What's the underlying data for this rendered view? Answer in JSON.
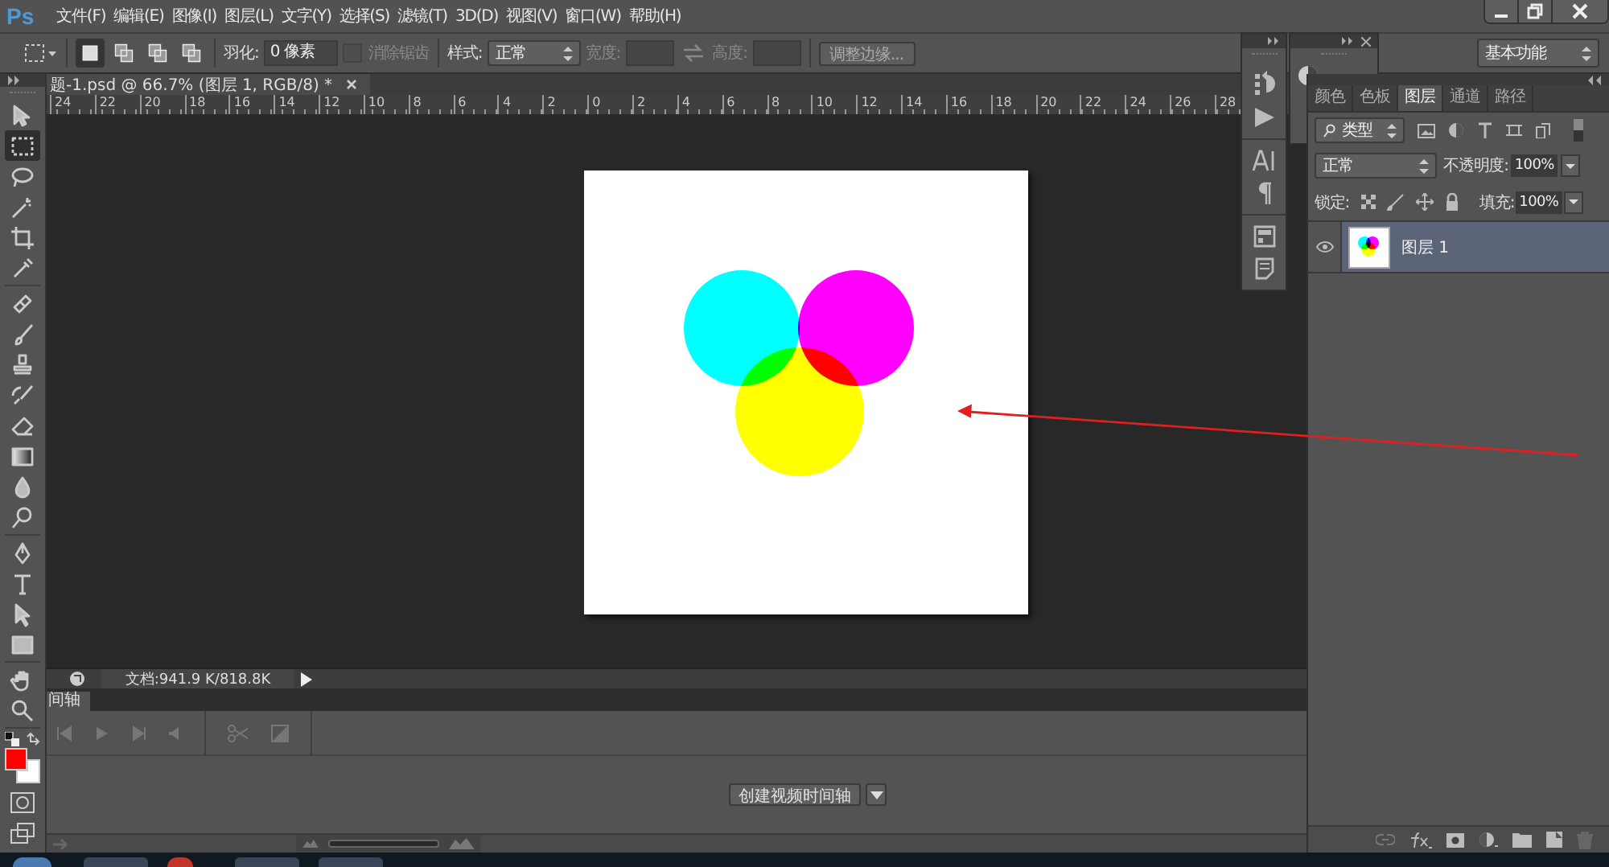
{
  "app": {
    "logo": "Ps"
  },
  "menu": [
    "文件(F)",
    "编辑(E)",
    "图像(I)",
    "图层(L)",
    "文字(Y)",
    "选择(S)",
    "滤镜(T)",
    "3D(D)",
    "视图(V)",
    "窗口(W)",
    "帮助(H)"
  ],
  "options_bar": {
    "selection_modes": [
      {
        "kind": "new",
        "selected": true
      },
      {
        "kind": "add",
        "selected": false
      },
      {
        "kind": "subtract",
        "selected": false
      },
      {
        "kind": "intersect",
        "selected": false
      }
    ],
    "feather_label": "羽化:",
    "feather_value": "0 像素",
    "antialias": {
      "label": "消除锯齿",
      "checked": false,
      "disabled": true
    },
    "style_label": "样式:",
    "style_value": "正常",
    "width_label": "宽度:",
    "height_label": "高度:",
    "refine_button": "调整边缘...",
    "workspace": "基本功能"
  },
  "document": {
    "tab": "题-1.psd @ 66.7% (图层 1, RGB/8) *",
    "ruler": [
      "24",
      "22",
      "20",
      "18",
      "16",
      "14",
      "12",
      "10",
      "8",
      "6",
      "4",
      "2",
      "0",
      "2",
      "4",
      "6",
      "8",
      "10",
      "12",
      "14",
      "16",
      "18",
      "20",
      "22",
      "24",
      "26",
      "28"
    ],
    "status": "文档:941.9 K/818.8K"
  },
  "tool_groups": [
    [
      {
        "kind": "move",
        "selected": false
      },
      {
        "kind": "marquee",
        "selected": true
      },
      {
        "kind": "lasso",
        "selected": false
      },
      {
        "kind": "magic-wand",
        "selected": false
      },
      {
        "kind": "crop",
        "selected": false
      },
      {
        "kind": "eyedropper",
        "selected": false
      }
    ],
    [
      {
        "kind": "healing-brush",
        "selected": false
      },
      {
        "kind": "brush",
        "selected": false
      },
      {
        "kind": "stamp",
        "selected": false
      },
      {
        "kind": "history-brush",
        "selected": false
      },
      {
        "kind": "eraser",
        "selected": false
      },
      {
        "kind": "gradient",
        "selected": false
      },
      {
        "kind": "blur",
        "selected": false
      },
      {
        "kind": "dodge",
        "selected": false
      }
    ],
    [
      {
        "kind": "pen",
        "selected": false
      },
      {
        "kind": "type",
        "selected": false
      },
      {
        "kind": "path-select",
        "selected": false
      },
      {
        "kind": "rectangle",
        "selected": false
      }
    ],
    [
      {
        "kind": "hand",
        "selected": false
      },
      {
        "kind": "zoom",
        "selected": false
      }
    ]
  ],
  "swatches": [
    {
      "kind": "foreground",
      "color": "#ff0000"
    },
    {
      "kind": "background",
      "color": "#ffffff"
    }
  ],
  "timeline": {
    "tab": "间轴",
    "create_button": "创建视频时间轴"
  },
  "layers_panel": {
    "tabs": [
      {
        "label": "颜色",
        "selected": false
      },
      {
        "label": "色板",
        "selected": false
      },
      {
        "label": "图层",
        "selected": true
      },
      {
        "label": "通道",
        "selected": false
      },
      {
        "label": "路径",
        "selected": false
      }
    ],
    "filter": "类型",
    "blend_mode": "正常",
    "opacity_label": "不透明度:",
    "opacity": "100%",
    "lock_label": "锁定:",
    "fill_label": "填充:",
    "fill": "100%",
    "layers": [
      {
        "name": "图层 1",
        "visible": true,
        "selected": true
      }
    ]
  }
}
